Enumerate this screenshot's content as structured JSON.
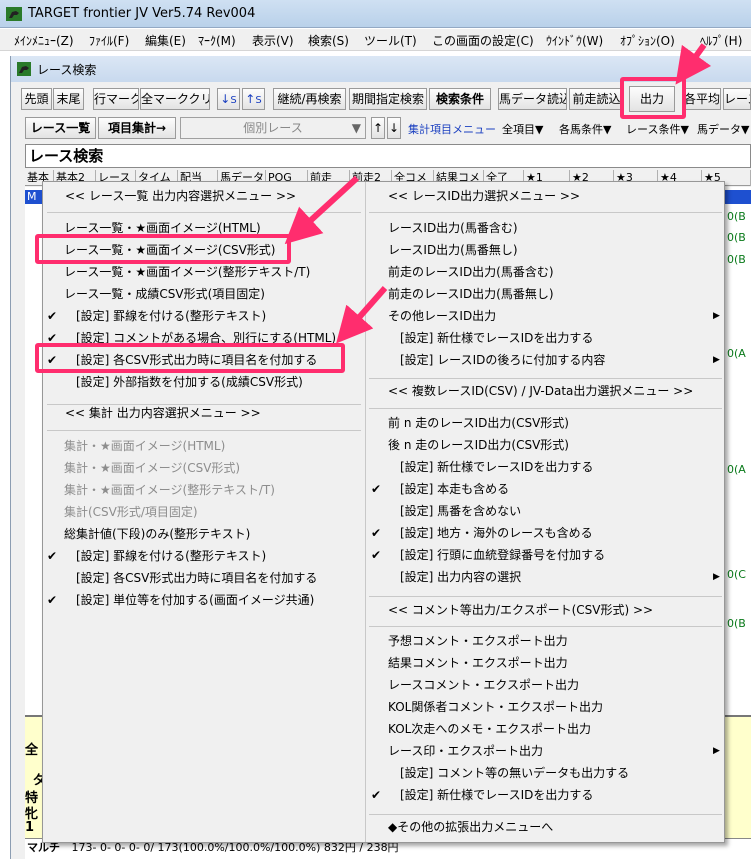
{
  "window": {
    "title": "TARGET frontier JV  Ver5.74  Rev004"
  },
  "menubar": [
    "ﾒｲﾝﾒﾆｭｰ(Z)",
    "ﾌｧｲﾙ(F)",
    "編集(E)",
    "ﾏｰｸ(M)",
    "表示(V)",
    "検索(S)",
    "ツール(T)",
    "この画面の設定(C)",
    "ｳｲﾝﾄﾞｳ(W)",
    "ｵﾌﾟｼｮﾝ(O)",
    "ﾍﾙﾌﾟ(H)"
  ],
  "subwindow": {
    "title": "レース検索"
  },
  "toolbar1": {
    "first": "先頭",
    "last": "末尾",
    "row_mark": "行マーク",
    "all_clear": "全マーククリア",
    "sort_down": "S",
    "sort_up": "S",
    "continue_research": "継続/再検索",
    "period_search": "期間指定検索",
    "search_cond": "検索条件",
    "horse_data_read": "馬データ読込",
    "prev_run_read": "前走読込",
    "output": "出力",
    "avg": "各平均",
    "race": "レース"
  },
  "toolbar2": {
    "race_list": "レース一覧",
    "item_total": "項目集計→",
    "individual_race": "個別レース",
    "agg_menu": "集計項目メニュー",
    "all_items": "全項目▼",
    "horse_cond": "各馬条件▼",
    "race_cond": "レース条件▼",
    "horse_data": "馬データ▼"
  },
  "search_title": "レース検索",
  "tabs": [
    "基本",
    "基本2",
    "レース",
    "タイム",
    "配当",
    "馬データ",
    "POG",
    "前走",
    "前走2",
    "全コメ",
    "結果コメ",
    "全了",
    "★1",
    "★2",
    "★3",
    "★4",
    "★5"
  ],
  "grid_first_cell": "M",
  "right_values": [
    "0(B",
    "0(B",
    "0(B",
    "0(A",
    "0(A",
    "0(C",
    "0(B"
  ],
  "bottom_panel": {
    "chars": [
      "全",
      "ダ",
      "特",
      "牝",
      "1"
    ],
    "last_label": "マルチ",
    "summary_row": "173-   0-   0-   0-   0/  173(100.0%/100.0%/100.0%)   832円 /   238円"
  },
  "menu_left": {
    "header1": "<< レース一覧 出力内容選択メニュー >>",
    "items1": [
      {
        "label": "レース一覧・★画面イメージ(HTML)",
        "checked": false,
        "disabled": false
      },
      {
        "label": "レース一覧・★画面イメージ(CSV形式)",
        "checked": false,
        "disabled": false
      },
      {
        "label": "レース一覧・★画面イメージ(整形テキスト/T)",
        "checked": false,
        "disabled": false
      },
      {
        "label": "レース一覧・成績CSV形式(項目固定)",
        "checked": false,
        "disabled": false
      },
      {
        "label": "[設定] 罫線を付ける(整形テキスト)",
        "checked": true,
        "disabled": false
      },
      {
        "label": "[設定] コメントがある場合、別行にする(HTML)",
        "checked": true,
        "disabled": false
      },
      {
        "label": "[設定] 各CSV形式出力時に項目名を付加する",
        "checked": true,
        "disabled": false
      },
      {
        "label": "[設定] 外部指数を付加する(成績CSV形式)",
        "checked": false,
        "disabled": false
      }
    ],
    "header2": "<< 集計  出力内容選択メニュー >>",
    "items2": [
      {
        "label": "集計・★画面イメージ(HTML)",
        "checked": false,
        "disabled": true
      },
      {
        "label": "集計・★画面イメージ(CSV形式)",
        "checked": false,
        "disabled": true
      },
      {
        "label": "集計・★画面イメージ(整形テキスト/T)",
        "checked": false,
        "disabled": true
      },
      {
        "label": "集計(CSV形式/項目固定)",
        "checked": false,
        "disabled": true
      },
      {
        "label": "総集計値(下段)のみ(整形テキスト)",
        "checked": false,
        "disabled": false
      },
      {
        "label": "[設定] 罫線を付ける(整形テキスト)",
        "checked": true,
        "disabled": false
      },
      {
        "label": "[設定] 各CSV形式出力時に項目名を付加する",
        "checked": false,
        "disabled": false
      },
      {
        "label": "[設定] 単位等を付加する(画面イメージ共通)",
        "checked": true,
        "disabled": false
      }
    ]
  },
  "menu_right": {
    "header1": "<< レースID出力選択メニュー >>",
    "items1": [
      {
        "label": "レースID出力(馬番含む)",
        "checked": false,
        "sub": false
      },
      {
        "label": "レースID出力(馬番無し)",
        "checked": false,
        "sub": false
      },
      {
        "label": "前走のレースID出力(馬番含む)",
        "checked": false,
        "sub": false
      },
      {
        "label": "前走のレースID出力(馬番無し)",
        "checked": false,
        "sub": false
      },
      {
        "label": "その他レースID出力",
        "checked": false,
        "sub": true
      },
      {
        "label": "[設定] 新仕様でレースIDを出力する",
        "checked": false,
        "sub": false
      },
      {
        "label": "[設定] レースIDの後ろに付加する内容",
        "checked": false,
        "sub": true
      }
    ],
    "header2": "<< 複数レースID(CSV) / JV-Data出力選択メニュー >>",
    "items2": [
      {
        "label": "前 n 走のレースID出力(CSV形式)",
        "checked": false,
        "sub": false
      },
      {
        "label": "後 n 走のレースID出力(CSV形式)",
        "checked": false,
        "sub": false
      },
      {
        "label": "[設定] 新仕様でレースIDを出力する",
        "checked": false,
        "sub": false
      },
      {
        "label": "[設定] 本走も含める",
        "checked": true,
        "sub": false
      },
      {
        "label": "[設定] 馬番を含めない",
        "checked": false,
        "sub": false
      },
      {
        "label": "[設定] 地方・海外のレースも含める",
        "checked": true,
        "sub": false
      },
      {
        "label": "[設定] 行頭に血統登録番号を付加する",
        "checked": true,
        "sub": false
      },
      {
        "label": "[設定] 出力内容の選択",
        "checked": false,
        "sub": true
      }
    ],
    "header3": "<<  コメント等出力/エクスポート(CSV形式)  >>",
    "items3": [
      {
        "label": "予想コメント・エクスポート出力",
        "checked": false,
        "sub": false
      },
      {
        "label": "結果コメント・エクスポート出力",
        "checked": false,
        "sub": false
      },
      {
        "label": "レースコメント・エクスポート出力",
        "checked": false,
        "sub": false
      },
      {
        "label": "KOL関係者コメント・エクスポート出力",
        "checked": false,
        "sub": false
      },
      {
        "label": "KOL次走へのメモ・エクスポート出力",
        "checked": false,
        "sub": false
      },
      {
        "label": "レース印・エクスポート出力",
        "checked": false,
        "sub": true
      },
      {
        "label": "[設定] コメント等の無いデータも出力する",
        "checked": false,
        "sub": false
      },
      {
        "label": "[設定] 新仕様でレースIDを出力する",
        "checked": true,
        "sub": false
      }
    ],
    "footer": "◆その他の拡張出力メニューへ"
  },
  "colors": {
    "highlight": "#ff2d6e",
    "selection": "#1e50d0",
    "bottom_panel": "#ffffcc"
  }
}
